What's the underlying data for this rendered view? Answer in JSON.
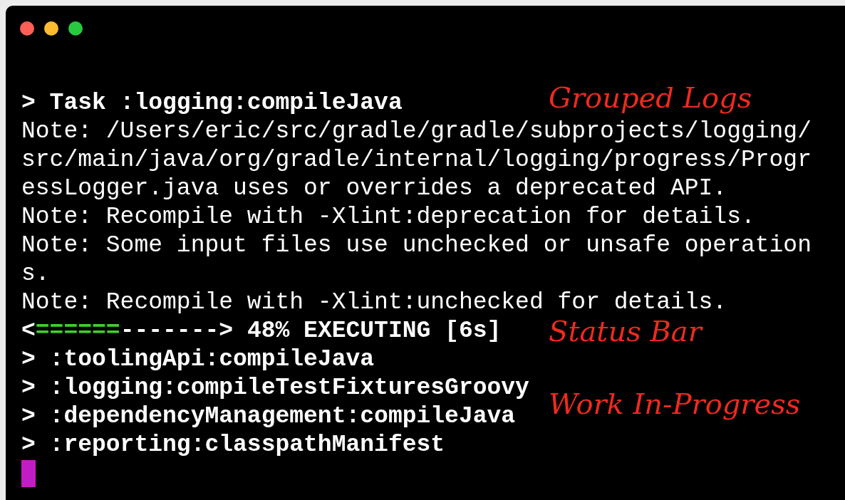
{
  "window": {
    "controls": [
      {
        "color": "#fe5f57"
      },
      {
        "color": "#febc2e"
      },
      {
        "color": "#28c840"
      }
    ]
  },
  "terminal": {
    "lines": [
      {
        "kind": "task",
        "text": "> Task :logging:compileJava",
        "annotation": "Grouped Logs"
      },
      {
        "kind": "note",
        "text": "Note: /Users/eric/src/gradle/gradle/subprojects/logging/"
      },
      {
        "kind": "note",
        "text": "src/main/java/org/gradle/internal/logging/progress/Progr"
      },
      {
        "kind": "note",
        "text": "essLogger.java uses or overrides a deprecated API."
      },
      {
        "kind": "note",
        "text": "Note: Recompile with -Xlint:deprecation for details."
      },
      {
        "kind": "note",
        "text": "Note: Some input files use unchecked or unsafe operation"
      },
      {
        "kind": "note",
        "text": "s."
      },
      {
        "kind": "note",
        "text": "Note: Recompile with -Xlint:unchecked for details."
      },
      {
        "kind": "progress",
        "start": "<",
        "filled": "======",
        "empty": "------->",
        "status": "48% EXECUTING [6s]",
        "annotation": "Status Bar"
      },
      {
        "kind": "work",
        "text": "> :toolingApi:compileJava"
      },
      {
        "kind": "work",
        "text": "> :logging:compileTestFixturesGroovy",
        "annotation": "Work In-Progress"
      },
      {
        "kind": "work",
        "text": "> :dependencyManagement:compileJava"
      },
      {
        "kind": "work",
        "text": "> :reporting:classpathManifest"
      }
    ]
  }
}
